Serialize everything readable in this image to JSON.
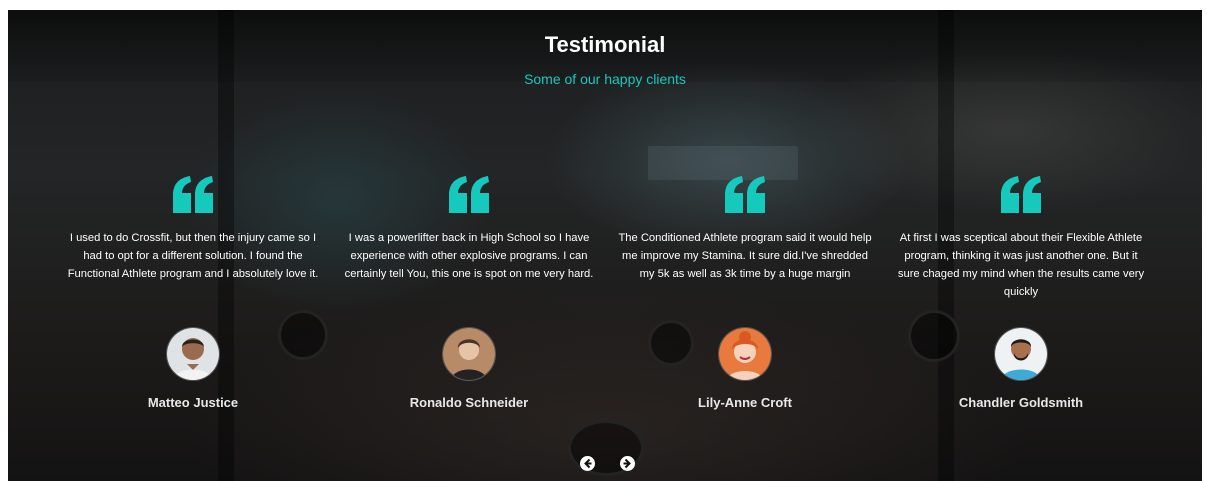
{
  "header": {
    "title": "Testimonial",
    "subtitle": "Some of our happy clients"
  },
  "colors": {
    "accent": "#16c9bd",
    "text": "#ffffff"
  },
  "testimonials": [
    {
      "quote": "I used to do Crossfit, but then the injury came so I had to opt for a different solution. I found the Functional Athlete program and I absolutely love it.",
      "name": "Matteo Justice",
      "avatar_icon": "person-avatar-icon"
    },
    {
      "quote": "I was a powerlifter back in High School so I have experience with other explosive programs. I can certainly tell You, this one is spot on me very hard.",
      "name": "Ronaldo Schneider",
      "avatar_icon": "person-avatar-icon"
    },
    {
      "quote": "The Conditioned Athlete program said it would help me improve my Stamina. It sure did.I've shredded my 5k as well as 3k time by a huge margin",
      "name": "Lily-Anne Croft",
      "avatar_icon": "person-avatar-icon"
    },
    {
      "quote": "At first I was sceptical about their Flexible Athlete program, thinking it was just another one. But it sure chaged my mind when the results came very quickly",
      "name": "Chandler Goldsmith",
      "avatar_icon": "person-avatar-icon"
    }
  ],
  "carousel": {
    "prev_icon": "arrow-left-circle-icon",
    "next_icon": "arrow-right-circle-icon"
  }
}
